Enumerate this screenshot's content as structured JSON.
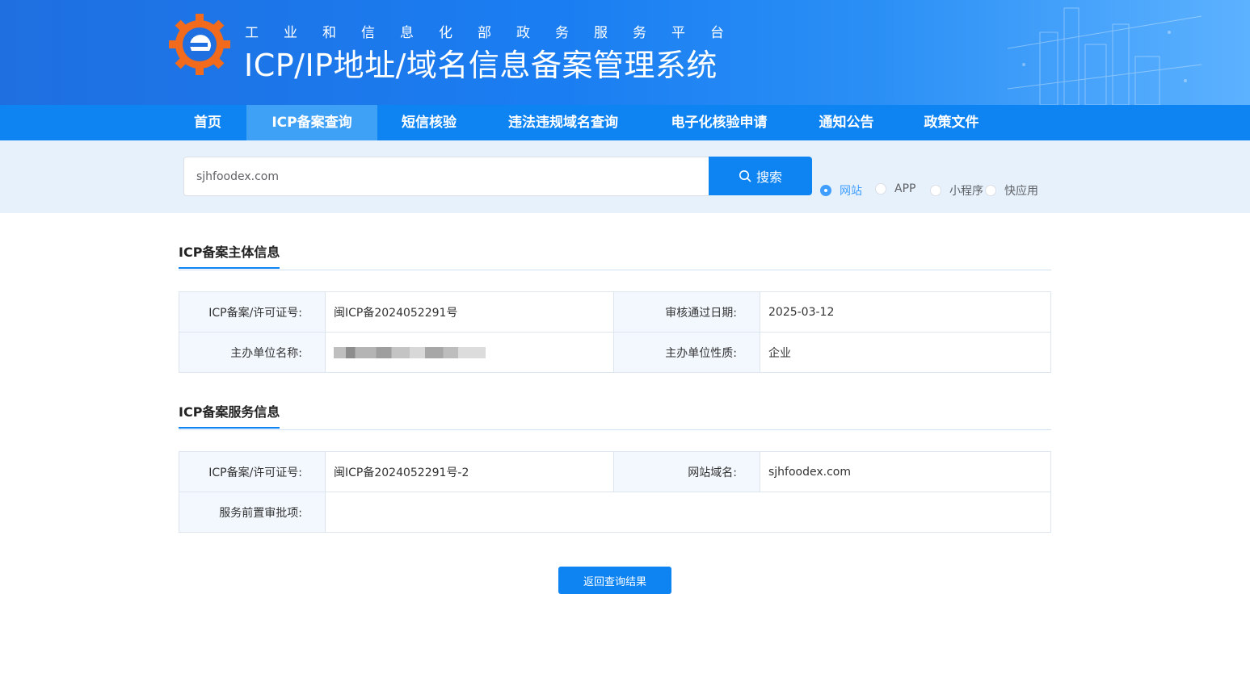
{
  "header": {
    "subtitle": "工业和信息化部政务服务平台",
    "title": "ICP/IP地址/域名信息备案管理系统"
  },
  "nav": {
    "items": [
      {
        "label": "首页",
        "active": false
      },
      {
        "label": "ICP备案查询",
        "active": true
      },
      {
        "label": "短信核验",
        "active": false
      },
      {
        "label": "违法违规域名查询",
        "active": false
      },
      {
        "label": "电子化核验申请",
        "active": false
      },
      {
        "label": "通知公告",
        "active": false
      },
      {
        "label": "政策文件",
        "active": false
      }
    ]
  },
  "search": {
    "value": "sjhfoodex.com",
    "button_label": "搜索",
    "types": [
      {
        "label": "网站",
        "checked": true
      },
      {
        "label": "APP",
        "checked": false
      },
      {
        "label": "小程序",
        "checked": false
      },
      {
        "label": "快应用",
        "checked": false
      }
    ]
  },
  "subject_info": {
    "title": "ICP备案主体信息",
    "license_label": "ICP备案/许可证号:",
    "license_value": "闽ICP备2024052291号",
    "approve_date_label": "审核通过日期:",
    "approve_date_value": "2025-03-12",
    "org_name_label": "主办单位名称:",
    "org_type_label": "主办单位性质:",
    "org_type_value": "企业"
  },
  "service_info": {
    "title": "ICP备案服务信息",
    "license_label": "ICP备案/许可证号:",
    "license_value": "闽ICP备2024052291号-2",
    "domain_label": "网站域名:",
    "domain_value": "sjhfoodex.com",
    "pre_approval_label": "服务前置审批项:",
    "pre_approval_value": ""
  },
  "back_button_label": "返回查询结果",
  "colors": {
    "primary": "#0d84f2",
    "nav_active": "#3fa1f6",
    "radio_checked": "#409eff",
    "search_band": "#e6f1fc"
  }
}
